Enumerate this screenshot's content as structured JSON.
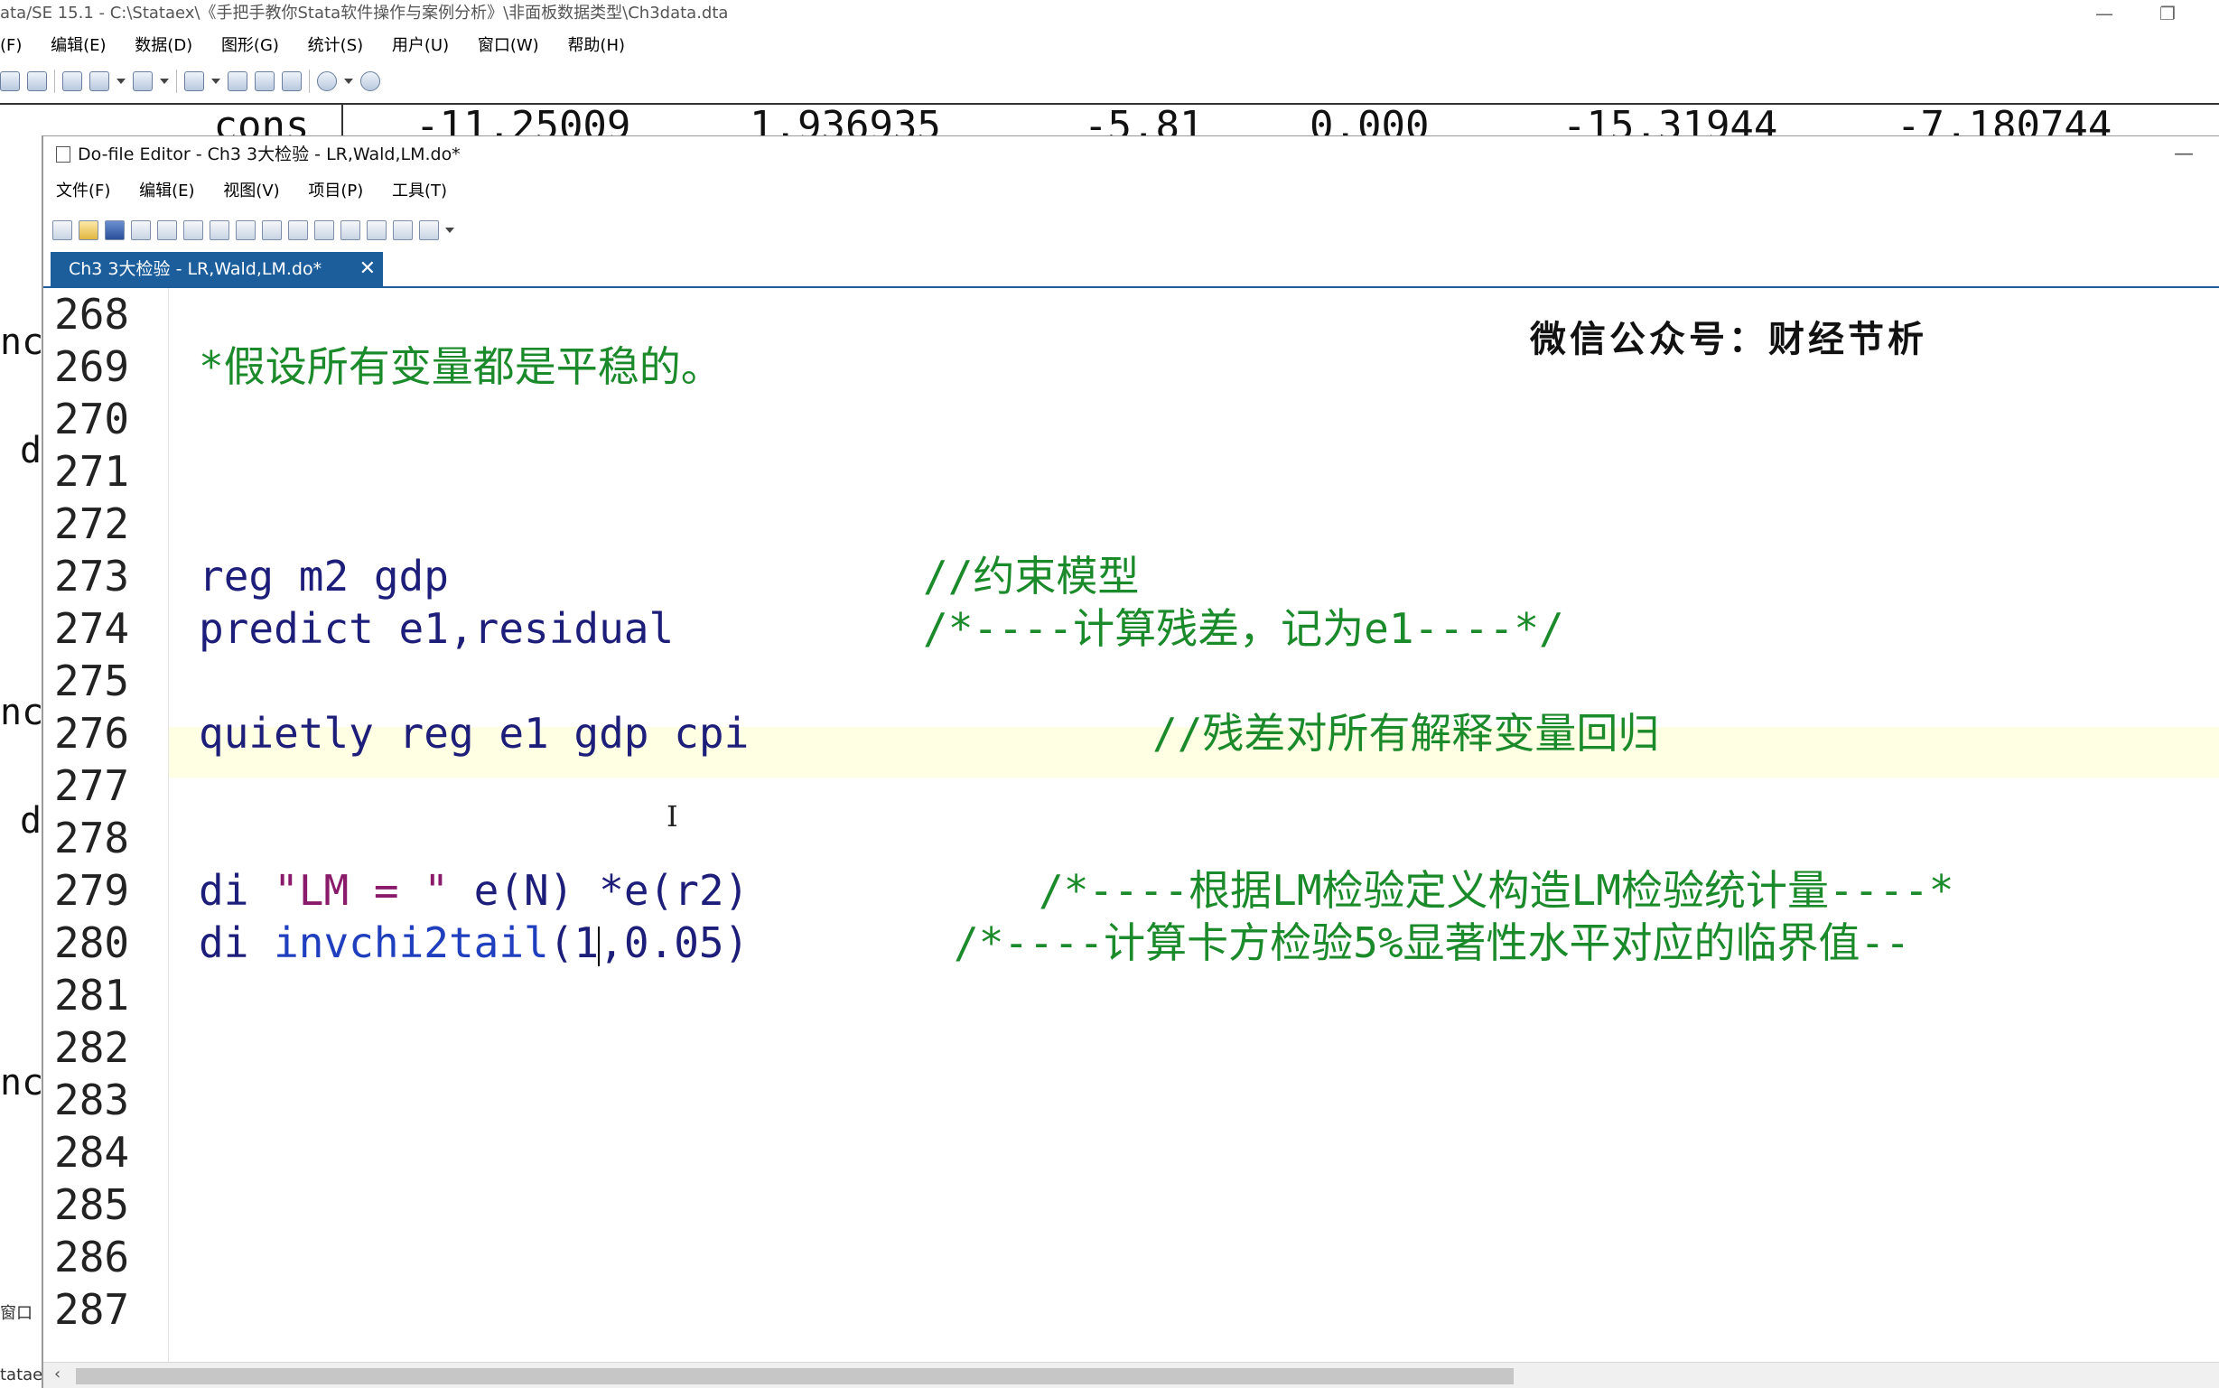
{
  "stata": {
    "title": "ata/SE 15.1 - C:\\Stataex\\《手把手教你Stata软件操作与案例分析》\\非面板数据类型\\Ch3data.dta",
    "menu": [
      "(F)",
      "编辑(E)",
      "数据(D)",
      "图形(G)",
      "统计(S)",
      "用户(U)",
      "窗口(W)",
      "帮助(H)"
    ],
    "results_row": [
      "_cons",
      "-11.25009",
      "1.936935",
      "-5.81",
      "0.000",
      "-15.31944",
      "-7.180744"
    ],
    "left_fragments": [
      "nc",
      "d",
      "nc",
      "d",
      "nc"
    ],
    "left_small": [
      "窗口",
      "tataex\\"
    ]
  },
  "editor": {
    "title": "Do-file Editor - Ch3 3大检验 - LR,Wald,LM.do*",
    "menu": [
      "文件(F)",
      "编辑(E)",
      "视图(V)",
      "项目(P)",
      "工具(T)"
    ],
    "tab_label": "Ch3 3大检验 - LR,Wald,LM.do*",
    "tab_close": "✕",
    "watermark": "微信公众号：财经节析",
    "line_numbers": [
      "268",
      "269",
      "270",
      "271",
      "272",
      "273",
      "274",
      "275",
      "276",
      "277",
      "278",
      "279",
      "280",
      "281",
      "282",
      "283",
      "284",
      "285",
      "286",
      "287"
    ],
    "lines": {
      "l269_comment": "*假设所有变量都是平稳的。",
      "l273_code": "reg m2 gdp",
      "l273_comment": "//约束模型",
      "l274_code": "predict e1,residual",
      "l274_comment": "/*----计算残差，记为e1----*/",
      "l276_code": "quietly reg e1 gdp cpi",
      "l276_comment": "//残差对所有解释变量回归",
      "l279_di": "di ",
      "l279_str": "\"LM = \"",
      "l279_rest": " e(N) *e(r2)",
      "l279_comment": "/*----根据LM检验定义构造LM检验统计量----*",
      "l280_di": "di ",
      "l280_fn": "invchi2tail",
      "l280_args_a": "(1",
      "l280_args_b": ",0.05)",
      "l280_comment": "/*----计算卡方检验5%显著性水平对应的临界值--"
    },
    "cursor_line": "280",
    "colors": {
      "comment": "#1b8a2a",
      "command": "#1d1d7a",
      "function": "#1f3fbf",
      "string": "#8a1a6a",
      "tab_active": "#1c5d9c",
      "current_line": "#ffffe3"
    },
    "icons": [
      "new-file-icon",
      "open-icon",
      "save-icon",
      "print-icon",
      "find-icon",
      "cut-icon",
      "copy-icon",
      "paste-icon",
      "undo-icon",
      "redo-icon",
      "indent-icon",
      "upload-icon",
      "download-icon",
      "preview-icon",
      "run-icon"
    ]
  }
}
